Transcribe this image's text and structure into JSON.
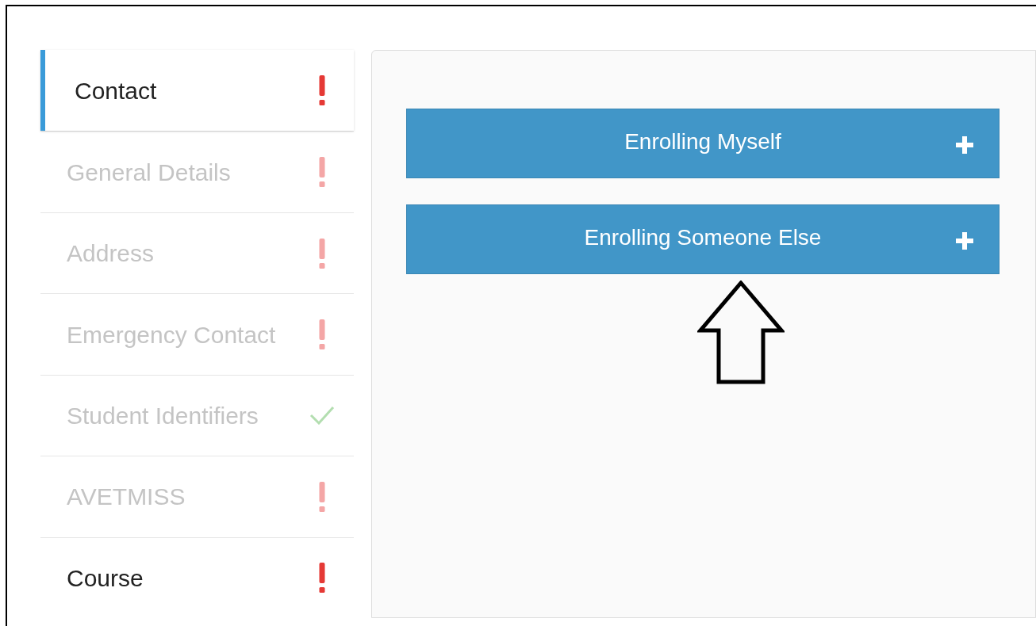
{
  "sidebar": {
    "items": [
      {
        "label": "Contact",
        "kind": "alert",
        "disabled": false,
        "selected": true
      },
      {
        "label": "General Details",
        "kind": "alert",
        "disabled": true,
        "selected": false
      },
      {
        "label": "Address",
        "kind": "alert",
        "disabled": true,
        "selected": false
      },
      {
        "label": "Emergency Contact",
        "kind": "alert",
        "disabled": true,
        "selected": false
      },
      {
        "label": "Student Identifiers",
        "kind": "done",
        "disabled": true,
        "selected": false
      },
      {
        "label": "AVETMISS",
        "kind": "alert",
        "disabled": true,
        "selected": false
      },
      {
        "label": "Course",
        "kind": "alert",
        "disabled": false,
        "selected": false
      }
    ]
  },
  "panel": {
    "buttons": [
      {
        "label": "Enrolling Myself"
      },
      {
        "label": "Enrolling Someone Else"
      }
    ]
  }
}
